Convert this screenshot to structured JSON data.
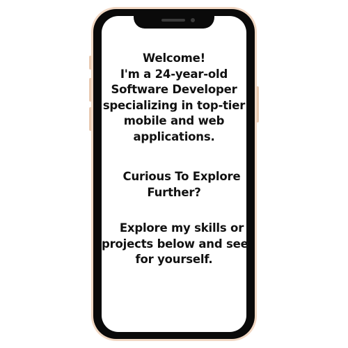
{
  "intro": {
    "lines": [
      "Welcome!",
      "I'm a 24-year-old",
      "Software Developer",
      "specializing in top-tier",
      "mobile and web",
      "applications."
    ]
  },
  "curious": {
    "lines": [
      "Curious To Explore",
      "Further?"
    ]
  },
  "explore": {
    "lines": [
      "Explore my skills or",
      "projects below and see",
      "for yourself."
    ]
  },
  "colors": {
    "rim": "#f1d8c4",
    "bezel": "#0a0a0a",
    "screen": "#ffffff",
    "text": "#111111"
  }
}
